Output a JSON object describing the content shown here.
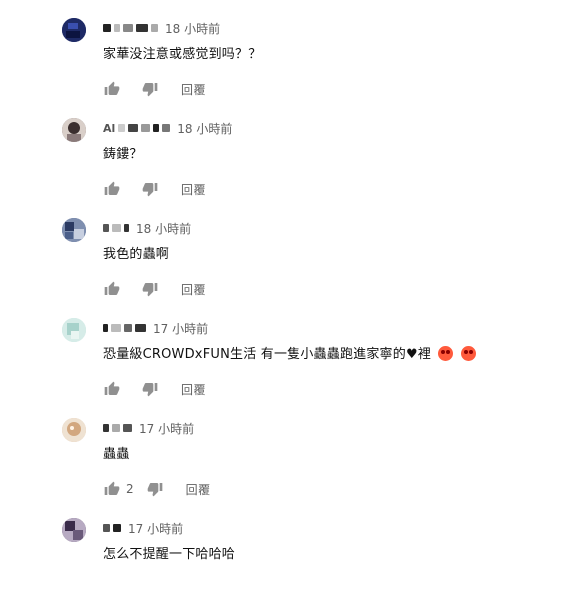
{
  "comments": [
    {
      "author_fragments": [
        "■"
      ],
      "time": "18 小時前",
      "text": "家華没注意或感觉到吗？？",
      "likes": "",
      "reply_label": "回覆",
      "avatar_color": "#1e2a66"
    },
    {
      "author_fragments": [
        "Al"
      ],
      "time": "18 小時前",
      "text": "鋳鏤？",
      "likes": "",
      "reply_label": "回覆",
      "avatar_color": "#5a4a4a"
    },
    {
      "author_fragments": [],
      "time": "18 小時前",
      "text": "我色的蟲啊",
      "likes": "",
      "reply_label": "回覆",
      "avatar_color": "#3b4f7a"
    },
    {
      "author_fragments": [],
      "time": "17 小時前",
      "text": "恐量級CROWDxFUN生活 有一隻小蟲蟲跑進家寧的",
      "text_suffix": "裡",
      "likes": "",
      "reply_label": "回覆",
      "avatar_color": "#b9ded8"
    },
    {
      "author_fragments": [],
      "time": "17 小時前",
      "text": "蟲蟲",
      "likes": "2",
      "reply_label": "回覆",
      "avatar_color": "#d8b89a"
    },
    {
      "author_fragments": [],
      "time": "17 小時前",
      "text": "怎么不提醒一下哈哈哈",
      "likes": "",
      "reply_label": "",
      "avatar_color": "#4b3a5a"
    }
  ]
}
